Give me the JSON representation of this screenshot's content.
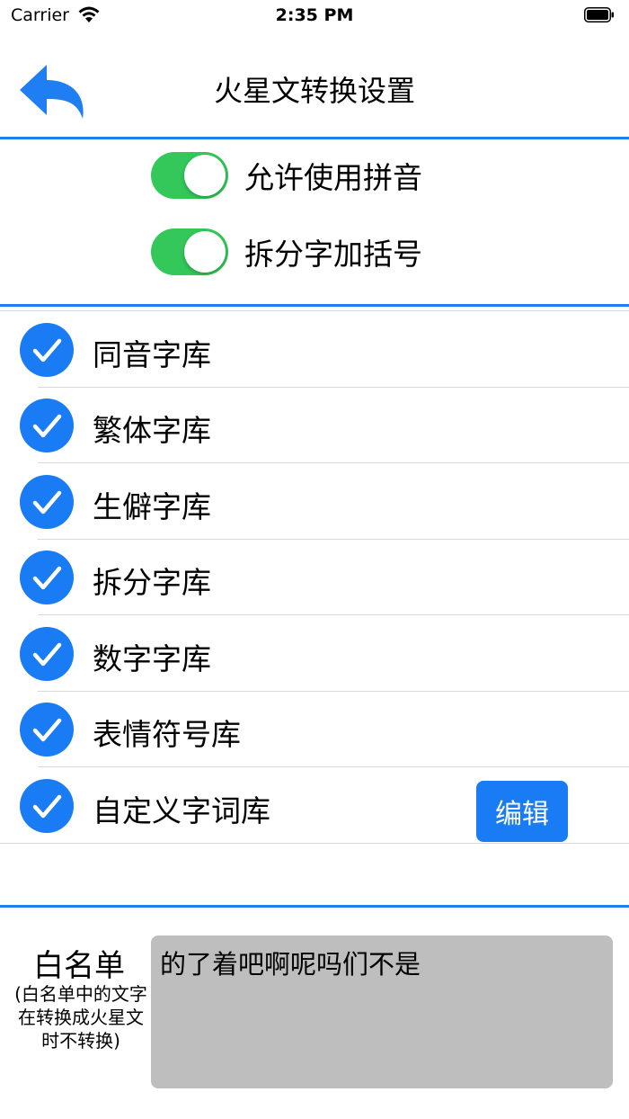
{
  "status_bar": {
    "carrier": "Carrier",
    "time": "2:35 PM",
    "icons": [
      "wifi-icon",
      "battery-icon"
    ]
  },
  "nav": {
    "title": "火星文转换设置",
    "back_icon": "reply-arrow-icon",
    "accent_color": "#1f7ff2"
  },
  "toggles": [
    {
      "label": "允许使用拼音",
      "on": true
    },
    {
      "label": "拆分字加括号",
      "on": true
    }
  ],
  "toggle_color": "#34c759",
  "libraries": [
    {
      "label": "同音字库",
      "checked": true
    },
    {
      "label": "繁体字库",
      "checked": true
    },
    {
      "label": "生僻字库",
      "checked": true
    },
    {
      "label": "拆分字库",
      "checked": true
    },
    {
      "label": "数字字库",
      "checked": true
    },
    {
      "label": "表情符号库",
      "checked": true
    },
    {
      "label": "自定义字词库",
      "checked": true
    }
  ],
  "edit_button_label": "编辑",
  "check_color": "#1a7cf5",
  "whitelist": {
    "title": "白名单",
    "description": "(白名单中的文字在转换成火星文时不转换)",
    "text": "的了着吧啊呢吗们不是"
  }
}
